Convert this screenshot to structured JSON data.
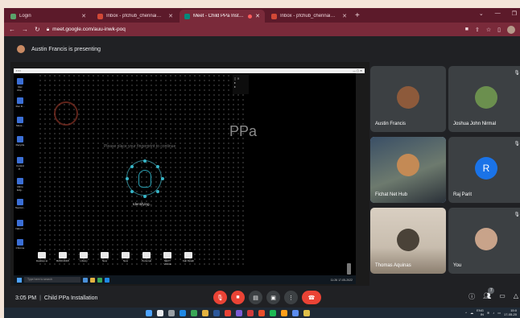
{
  "tabs": [
    {
      "title": "Login",
      "color": "#5aa36a",
      "active": false
    },
    {
      "title": "Inbox - pfchub_chennai@homeli...",
      "color": "#d14836",
      "active": false
    },
    {
      "title": "Meet - Child PPa Installation",
      "color": "#00897b",
      "active": true
    },
    {
      "title": "Inbox - pfchub_chennai@homeli...",
      "color": "#d14836",
      "active": false
    }
  ],
  "new_tab_label": "+",
  "url": "meet.google.com/auu-inwk-poq",
  "presenting_banner": "Austin Francis is presenting",
  "shared_screen": {
    "brand_text": "PPa",
    "hint_text": "Please place your fingerprint to continue",
    "status_text": "Identifying...",
    "search_placeholder": "Type here to search",
    "taskbar_time": "11:26",
    "taskbar_date": "17-05-2022",
    "desktop_icons": [
      "Rec Cha...",
      "Doc D...",
      "Mess...",
      "Recycle",
      "Control P...",
      "Micro Edg...",
      "Teamvi...",
      "Nalu P...",
      "Chrome"
    ],
    "window_icons": [
      "Desktop at",
      "BANKADMI",
      "Library",
      "New",
      "New",
      "Personal",
      "NEXT VOICE",
      "Kali Xlpath"
    ]
  },
  "participants": [
    {
      "name": "Austin Francis",
      "avatar_color": "#8d5a3b",
      "muted": false
    },
    {
      "name": "Joshua John Nirmal",
      "avatar_color": "#6b8f4e",
      "muted": true
    },
    {
      "name": "Fichat Net Hub",
      "avatar_color": "#2a3a4c",
      "muted": false
    },
    {
      "name": "Raj Parit",
      "initial": "R",
      "muted": true
    },
    {
      "name": "Thomas Aquinas",
      "avatar_color": "#4a4238",
      "muted": false
    },
    {
      "name": "You",
      "avatar_color": "#c8a38a",
      "muted": true
    }
  ],
  "meeting": {
    "time": "3:05 PM",
    "title": "Child PPa Installation",
    "participants_count": "7"
  },
  "controls": [
    "mic-off",
    "camera-off",
    "captions",
    "present",
    "more",
    "end-call"
  ],
  "host_taskbar": {
    "lang": "ENG",
    "lang2": "IN",
    "time": "15:0",
    "date": "17-05-20"
  },
  "colors": {
    "tab_strip": "#5c1a2a",
    "address_bar": "#7a2a3a",
    "meet_bg": "#202124",
    "tile_bg": "#3c4043",
    "danger": "#ea4335",
    "accent": "#8ab4f8"
  }
}
